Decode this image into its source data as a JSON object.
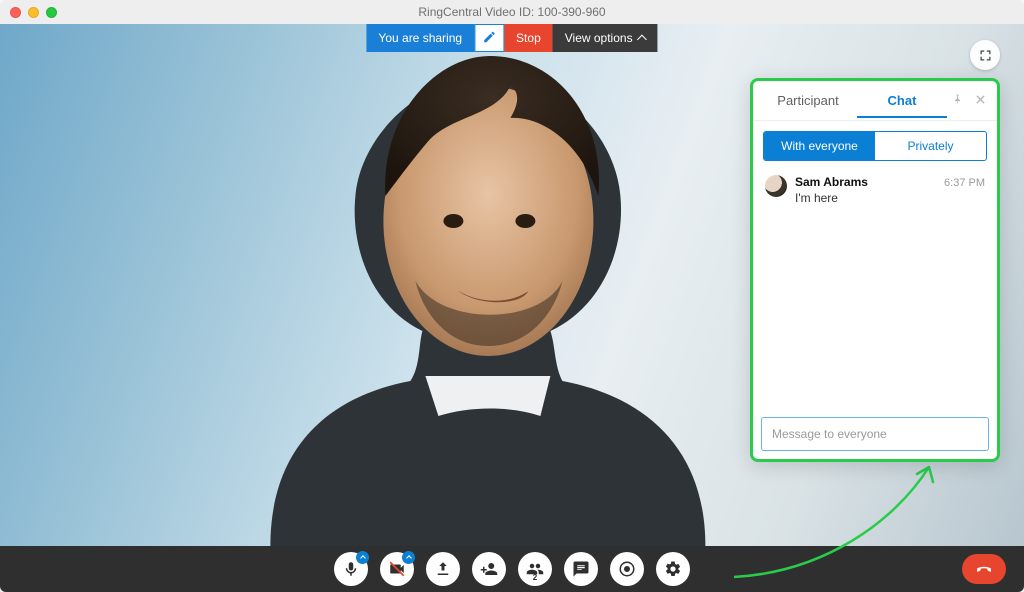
{
  "window": {
    "title": "RingCentral Video ID: 100-390-960"
  },
  "share_bar": {
    "sharing_label": "You are sharing",
    "stop_label": "Stop",
    "view_options_label": "View options"
  },
  "chat": {
    "tab_participant": "Participant",
    "tab_chat": "Chat",
    "scope_everyone": "With everyone",
    "scope_private": "Privately",
    "input_placeholder": "Message to everyone",
    "messages": [
      {
        "name": "Sam Abrams",
        "time": "6:37 PM",
        "text": "I'm here"
      }
    ]
  },
  "toolbar": {
    "participant_count": "2",
    "icons": [
      "mic",
      "camera",
      "share",
      "add-person",
      "participants",
      "chat",
      "record",
      "settings"
    ]
  },
  "colors": {
    "accent": "#0a7fd4",
    "highlight_border": "#29cc4a",
    "danger": "#e7452d"
  }
}
